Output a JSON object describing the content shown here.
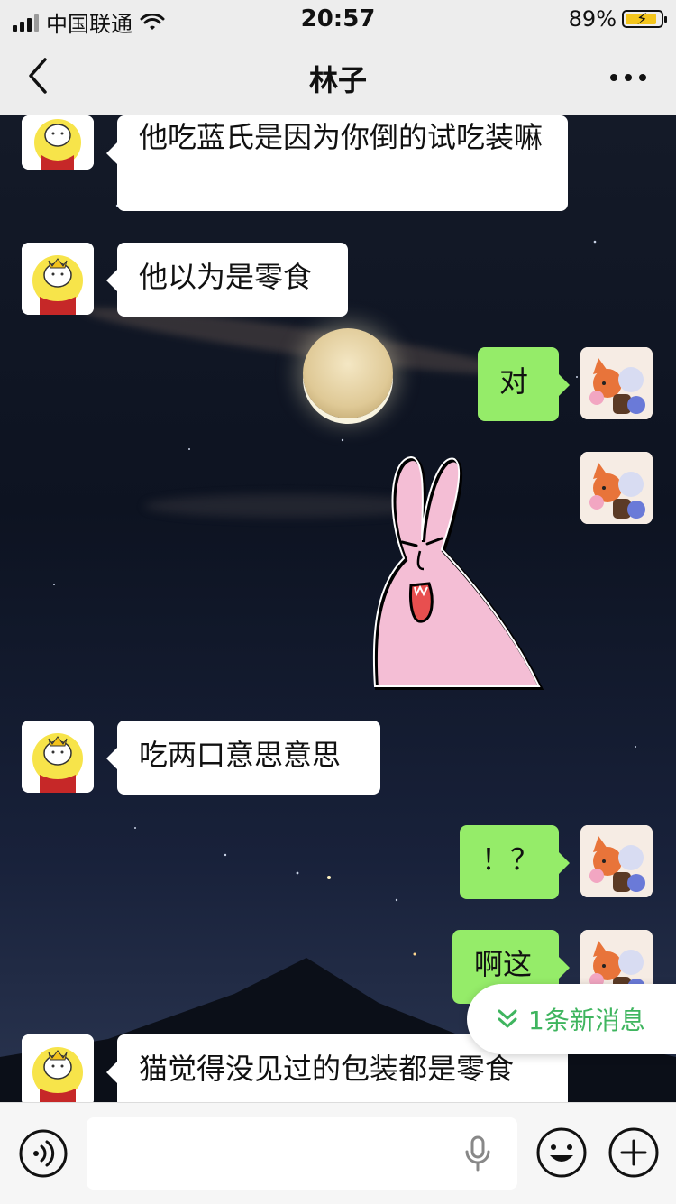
{
  "status_bar": {
    "carrier": "中国联通",
    "time": "20:57",
    "battery_text": "89%",
    "battery_level": 0.89
  },
  "nav": {
    "title": "林子"
  },
  "messages": [
    {
      "side": "left",
      "text": "他吃蓝氏是因为你倒的试吃装嘛"
    },
    {
      "side": "left",
      "text": "他以为是零食"
    },
    {
      "side": "right",
      "text": "对"
    },
    {
      "side": "right",
      "type": "sticker",
      "sticker": "pink-rabbit-sticker"
    },
    {
      "side": "left",
      "text": "吃两口意思意思"
    },
    {
      "side": "right",
      "text": "！？"
    },
    {
      "side": "right",
      "text": "啊这"
    },
    {
      "side": "left",
      "text": "猫觉得没见过的包装都是零食"
    }
  ],
  "new_message_pill": {
    "text": "1条新消息"
  },
  "input": {
    "value": ""
  },
  "colors": {
    "green_bubble": "#95ec69",
    "accent": "#3fb55f",
    "bar_bg": "#ededed"
  }
}
